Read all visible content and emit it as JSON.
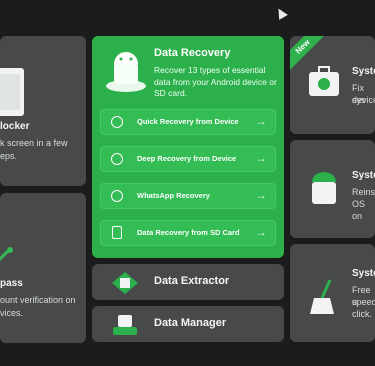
{
  "left_cards": {
    "unlocker": {
      "title": "locker",
      "desc": [
        "k screen in a few",
        "eps."
      ]
    },
    "bypass": {
      "title": "pass",
      "desc": [
        "ount verification on",
        "vices."
      ]
    }
  },
  "data_recovery": {
    "title": "Data Recovery",
    "desc": "Recover 13 types of essential data from your Android device or SD card.",
    "options": [
      {
        "label": "Quick Recovery from Device"
      },
      {
        "label": "Deep Recovery from Device"
      },
      {
        "label": "WhatsApp Recovery"
      },
      {
        "label": "Data Recovery from SD Card"
      }
    ]
  },
  "data_extractor": {
    "title": "Data Extractor"
  },
  "data_manager": {
    "title": "Data Manager"
  },
  "right_cards": {
    "badge": "New",
    "sys1": {
      "title": "Syste",
      "desc": [
        "Fix sys",
        "device"
      ]
    },
    "sys2": {
      "title": "Syste",
      "desc": [
        "Reinst",
        "OS on"
      ]
    },
    "sys3": {
      "title": "Syste",
      "desc": [
        "Free u",
        "speed",
        "click."
      ]
    }
  },
  "colors": {
    "accent_green": "#2bb04b",
    "card": "#474a49",
    "background": "#1b1d1c"
  }
}
